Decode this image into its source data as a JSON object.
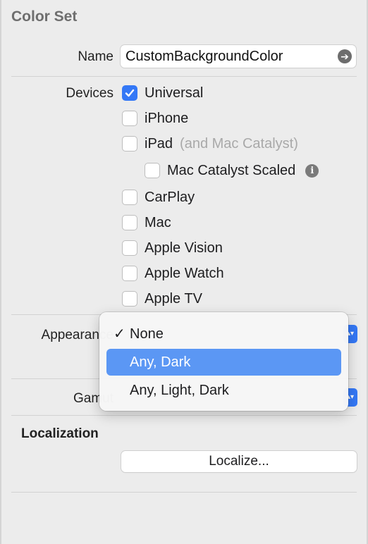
{
  "panel": {
    "title": "Color Set",
    "name_label": "Name",
    "name_value": "CustomBackgroundColor",
    "devices_label": "Devices",
    "devices": [
      {
        "label": "Universal",
        "checked": true
      },
      {
        "label": "iPhone",
        "checked": false
      },
      {
        "label": "iPad",
        "note": "(and Mac Catalyst)",
        "checked": false
      },
      {
        "label": "Mac Catalyst Scaled",
        "checked": false,
        "info": true
      },
      {
        "label": "CarPlay",
        "checked": false
      },
      {
        "label": "Mac",
        "checked": false
      },
      {
        "label": "Apple Vision",
        "checked": false
      },
      {
        "label": "Apple Watch",
        "checked": false
      },
      {
        "label": "Apple TV",
        "checked": false
      }
    ],
    "appearance_label": "Appearance",
    "gamut_label": "Gamut",
    "localization_title": "Localization",
    "localize_button": "Localize..."
  },
  "menu": {
    "items": [
      {
        "label": "None",
        "checked": true,
        "highlighted": false
      },
      {
        "label": "Any, Dark",
        "checked": false,
        "highlighted": true
      },
      {
        "label": "Any, Light, Dark",
        "checked": false,
        "highlighted": false
      }
    ],
    "check_glyph": "✓"
  },
  "colors": {
    "accent": "#3478f6",
    "highlight": "#5b97f4",
    "background": "#ececec"
  }
}
